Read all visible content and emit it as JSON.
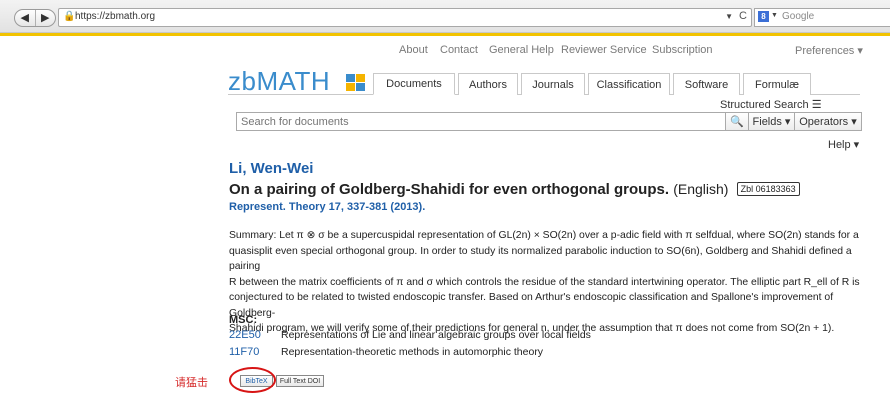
{
  "browser": {
    "url": "https://zbmath.org",
    "search_engine": "Google",
    "back": "◀",
    "forward": "▶",
    "reload": "C"
  },
  "top_links": [
    "About",
    "Contact",
    "General Help",
    "Reviewer Service",
    "Subscription"
  ],
  "preferences": "Preferences ▾",
  "logo_text": "zbMATH",
  "tabs": [
    "Documents",
    "Authors",
    "Journals",
    "Classification",
    "Software",
    "Formulæ"
  ],
  "active_tab": "Documents",
  "structured_search": "Structured Search ☰",
  "search": {
    "placeholder": "Search for documents",
    "fields": "Fields ▾",
    "operators": "Operators ▾"
  },
  "help": "Help ▾",
  "document": {
    "author": "Li, Wen-Wei",
    "title": "On a pairing of Goldberg-Shahidi for even orthogonal groups.",
    "language": "(English)",
    "zbl": "Zbl 06183363",
    "source": "Represent. Theory 17, 337-381 (2013).",
    "summary_lines": [
      "Summary: Let π ⊗ σ be a supercuspidal representation of GL(2n) × SO(2n) over a p-adic field with π selfdual, where SO(2n) stands for a",
      "quasisplit even special orthogonal group. In order to study its normalized parabolic induction to SO(6n), Goldberg and Shahidi defined a pairing",
      "R between the matrix coefficients of π and σ which controls the residue of the standard intertwining operator. The elliptic part R_ell of R is",
      "conjectured to be related to twisted endoscopic transfer. Based on Arthur's endoscopic classification and Spallone's improvement of Goldberg-",
      "Shahidi program, we will verify some of their predictions for general n, under the assumption that π does not come from SO(2n + 1)."
    ]
  },
  "msc": {
    "label": "MSC:",
    "items": [
      {
        "code": "22E50",
        "desc": "Representations of Lie and linear algebraic groups over local fields"
      },
      {
        "code": "11F70",
        "desc": "Representation-theoretic methods in automorphic theory"
      }
    ]
  },
  "buttons": {
    "bibtex": "BibTeX",
    "fulltext": "Full Text DOI"
  },
  "annotation": "请猛击",
  "colors": {
    "link_blue": "#1f5fa8",
    "logo_blue": "#3a8ccc",
    "annotation_red": "#d71414",
    "chrome_highlight": "#f2c300"
  }
}
